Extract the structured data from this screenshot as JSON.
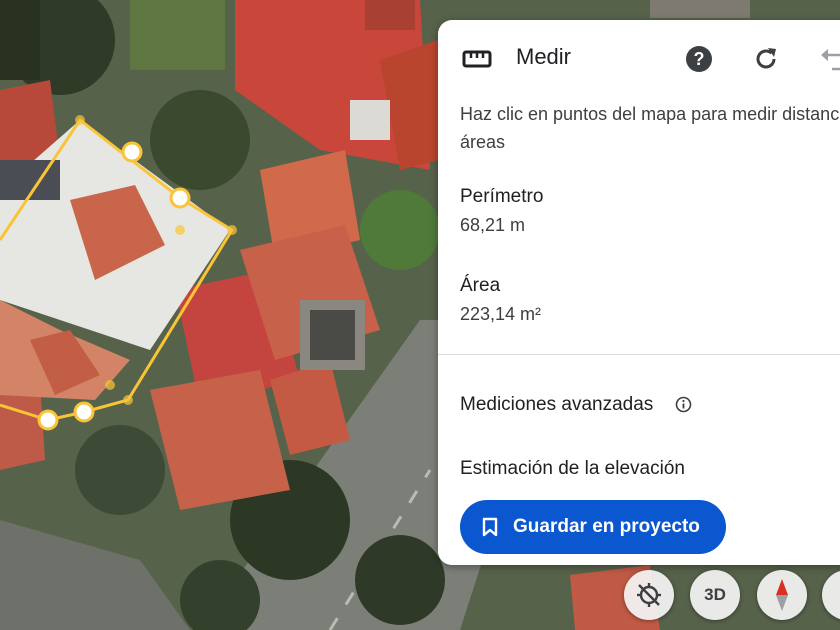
{
  "panel": {
    "title": "Medir",
    "description": "Haz clic en puntos del mapa para medir distancias y áreas",
    "perimeter_label": "Perímetro",
    "perimeter_value": "68,21 m",
    "area_label": "Área",
    "area_value": "223,14 m²",
    "advanced_label": "Mediciones avanzadas",
    "elevation_label": "Estimación de la elevación",
    "save_button": "Guardar en proyecto"
  },
  "map_controls": {
    "view_3d_label": "3D"
  },
  "colors": {
    "accent": "#0b57d0",
    "measure_line": "#f9c437"
  }
}
